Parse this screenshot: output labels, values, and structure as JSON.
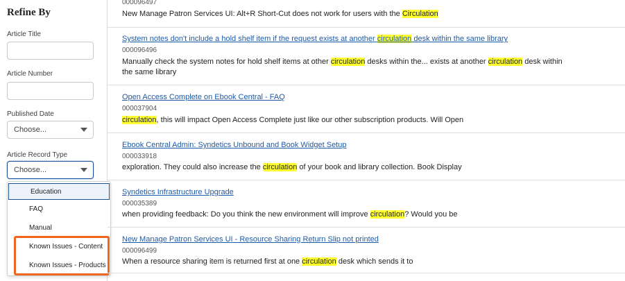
{
  "sidebar": {
    "title": "Refine By",
    "article_title_label": "Article Title",
    "article_number_label": "Article Number",
    "published_date_label": "Published Date",
    "published_date_value": "Choose...",
    "record_type_label": "Article Record Type",
    "record_type_value": "Choose...",
    "record_type_options": [
      "Education",
      "FAQ",
      "Manual",
      "Known Issues - Content",
      "Known Issues - Products"
    ]
  },
  "highlight_term": "circulation",
  "highlight_color": "#ffff2e",
  "callout_color": "#f0661e",
  "results": [
    {
      "title": "",
      "number": "000096497",
      "snippet_pre": "New Manage Patron Services UI: Alt+R Short-Cut does not work for users with the ",
      "snippet_hl": "Circulation",
      "snippet_post": ""
    },
    {
      "title_pre": "System notes don't include a hold shelf item if the request exists at another ",
      "title_hl": "circulation",
      "title_post": " desk within the same library",
      "number": "000096496",
      "snippet_pre": "Manually check the system notes for hold shelf items at other ",
      "snippet_hl": "circulation",
      "snippet_mid": " desks within the... exists at another ",
      "snippet_hl2": "circulation",
      "snippet_post": " desk within",
      "snippet_line2": "the same library"
    },
    {
      "title": "Open Access Complete on Ebook Central - FAQ",
      "number": "000037904",
      "snippet_pre": "",
      "snippet_hl": "circulation",
      "snippet_post": ", this will impact Open Access Complete just like our other subscription products. Will Open"
    },
    {
      "title": "Ebook Central Admin: Syndetics Unbound and Book Widget Setup",
      "number": "000033918",
      "snippet_pre": "exploration. They could also increase the ",
      "snippet_hl": "circulation",
      "snippet_post": " of your book and library collection. Book Display"
    },
    {
      "title": "Syndetics Infrastructure Upgrade",
      "number": "000035389",
      "snippet_pre": "when providing feedback: Do you think the new environment will improve ",
      "snippet_hl": "circulation",
      "snippet_post": "? Would you be"
    },
    {
      "title": "New Manage Patron Services UI - Resource Sharing Return Slip not printed",
      "number": "000096499",
      "snippet_pre": "When a resource sharing item is returned first at one ",
      "snippet_hl": "circulation",
      "snippet_post": " desk which sends it to"
    }
  ]
}
